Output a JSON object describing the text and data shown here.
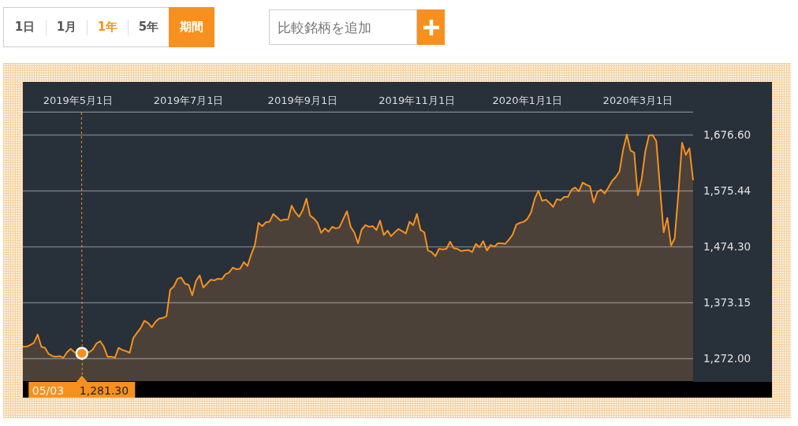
{
  "period_tabs": [
    {
      "label": "1日",
      "selected": false
    },
    {
      "label": "1月",
      "selected": false
    },
    {
      "label": "1年",
      "selected": true
    },
    {
      "label": "5年",
      "selected": false
    }
  ],
  "custom_period_button": {
    "label": "期間"
  },
  "compare_field": {
    "placeholder": "比較銘柄を追加"
  },
  "chart": {
    "chart_data": {
      "type": "area",
      "grid": true,
      "categories": [
        null,
        null,
        null,
        null,
        null,
        null,
        null,
        null,
        null,
        null,
        null,
        null,
        null,
        null,
        null,
        "2019年5月1日",
        null,
        null,
        null,
        null,
        null,
        null,
        null,
        null,
        null,
        null,
        null,
        null,
        null,
        null,
        null,
        null,
        null,
        null,
        null,
        null,
        null,
        null,
        null,
        null,
        null,
        null,
        null,
        null,
        null,
        "2019年7月1日",
        null,
        null,
        null,
        null,
        null,
        null,
        null,
        null,
        null,
        null,
        null,
        null,
        null,
        null,
        null,
        null,
        null,
        null,
        null,
        null,
        null,
        null,
        null,
        null,
        null,
        null,
        null,
        null,
        null,
        null,
        "2019年9月1日",
        null,
        null,
        null,
        null,
        null,
        null,
        null,
        null,
        null,
        null,
        null,
        null,
        null,
        null,
        null,
        null,
        null,
        null,
        null,
        null,
        null,
        null,
        null,
        null,
        null,
        null,
        null,
        null,
        null,
        null,
        "2019年11月1日",
        null,
        null,
        null,
        null,
        null,
        null,
        null,
        null,
        null,
        null,
        null,
        null,
        null,
        null,
        null,
        null,
        null,
        null,
        null,
        null,
        null,
        null,
        null,
        null,
        null,
        null,
        null,
        null,
        null,
        "2020年1月1日",
        null,
        null,
        null,
        null,
        null,
        null,
        null,
        null,
        null,
        null,
        null,
        null,
        null,
        null,
        null,
        null,
        null,
        null,
        null,
        null,
        null,
        null,
        null,
        null,
        null,
        null,
        null,
        null,
        null,
        "2020年3月1日",
        null,
        null,
        null,
        null,
        null,
        null,
        null,
        null,
        null,
        null,
        null,
        null,
        null,
        null,
        null
      ],
      "series": [
        {
          "color": "#f7901e",
          "values": [
            1293,
            1293,
            1296,
            1300,
            1315,
            1293,
            1291,
            1280,
            1276,
            1275,
            1276,
            1273,
            1283,
            1289,
            1283,
            1281,
            1281,
            1284,
            1283,
            1288,
            1299,
            1303,
            1293,
            1275,
            1275,
            1273,
            1291,
            1287,
            1285,
            1282,
            1309,
            1318,
            1327,
            1340,
            1336,
            1328,
            1338,
            1344,
            1345,
            1348,
            1396,
            1402,
            1416,
            1418,
            1407,
            1405,
            1386,
            1412,
            1422,
            1400,
            1407,
            1414,
            1413,
            1416,
            1415,
            1424,
            1427,
            1436,
            1433,
            1434,
            1446,
            1439,
            1460,
            1477,
            1517,
            1511,
            1518,
            1519,
            1533,
            1527,
            1521,
            1523,
            1523,
            1548,
            1536,
            1528,
            1540,
            1561,
            1530,
            1525,
            1517,
            1499,
            1507,
            1501,
            1510,
            1507,
            1509,
            1524,
            1538,
            1510,
            1500,
            1480,
            1505,
            1513,
            1510,
            1511,
            1504,
            1521,
            1495,
            1503,
            1493,
            1500,
            1506,
            1502,
            1498,
            1519,
            1513,
            1533,
            1504,
            1500,
            1467,
            1464,
            1457,
            1470,
            1469,
            1470,
            1483,
            1471,
            1470,
            1466,
            1467,
            1468,
            1464,
            1479,
            1473,
            1484,
            1467,
            1477,
            1474,
            1480,
            1480,
            1479,
            1487,
            1496,
            1514,
            1517,
            1519,
            1524,
            1536,
            1561,
            1575,
            1557,
            1559,
            1553,
            1546,
            1560,
            1558,
            1564,
            1564,
            1577,
            1581,
            1574,
            1590,
            1586,
            1583,
            1554,
            1573,
            1577,
            1570,
            1581,
            1593,
            1600,
            1610,
            1650,
            1677,
            1648,
            1644,
            1567,
            1595,
            1646,
            1675,
            1676,
            1665,
            1581,
            1500,
            1526,
            1476,
            1489,
            1570,
            1662,
            1640,
            1652,
            1594
          ]
        }
      ],
      "ylim": [
        1229.3,
        1716.5
      ],
      "yticks": [
        {
          "value": 1676.6,
          "label": "1,676.60"
        },
        {
          "value": 1575.44,
          "label": "1,575.44"
        },
        {
          "value": 1474.3,
          "label": "1,474.30"
        },
        {
          "value": 1373.15,
          "label": "1,373.15"
        },
        {
          "value": 1272,
          "label": "1,272.00"
        }
      ]
    },
    "crosshair": {
      "level": 0.088,
      "date": "05/03",
      "value": "1,281.30"
    }
  }
}
